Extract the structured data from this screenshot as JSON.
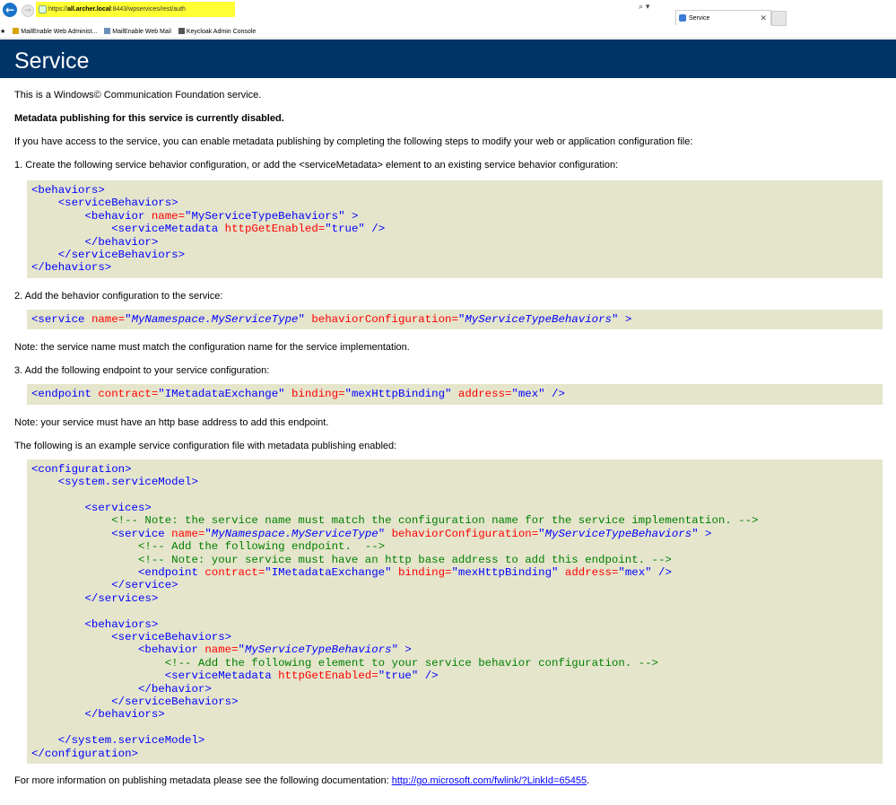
{
  "browser": {
    "address_url_prefix": "https://",
    "address_host": "all.archer.local",
    "address_path": ":8443/wpservices/rest/auth",
    "search_label": "⌕ ▾",
    "tab_title": "Service",
    "tab_close": "✕",
    "favorites": [
      {
        "label": "MailEnable Web Administ..."
      },
      {
        "label": "MailEnable Web Mail"
      },
      {
        "label": "Keycloak Admin Console"
      }
    ]
  },
  "page": {
    "header": "Service",
    "intro": "This is a Windows© Communication Foundation service.",
    "metadata_disabled": "Metadata publishing for this service is currently disabled.",
    "access_text": "If you have access to the service, you can enable metadata publishing by completing the following steps to modify your web or application configuration file:",
    "step1": "1. Create the following service behavior configuration, or add the <serviceMetadata> element to an existing service behavior configuration:",
    "step2": "2. Add the behavior configuration to the service:",
    "note1": "Note: the service name must match the configuration name for the service implementation.",
    "step3": "3. Add the following endpoint to your service configuration:",
    "note2": "Note: your service must have an http base address to add this endpoint.",
    "example_intro": "The following is an example service configuration file with metadata publishing enabled:",
    "footer_text": "For more information on publishing metadata please see the following documentation: ",
    "footer_link": "http://go.microsoft.com/fwlink/?LinkId=65455",
    "footer_end": "."
  },
  "code": {
    "tag_behaviors_open": "<behaviors>",
    "tag_behaviors_close": "</behaviors>",
    "tag_serviceBehaviors_open": "<serviceBehaviors>",
    "tag_serviceBehaviors_close": "</serviceBehaviors>",
    "tag_behavior_open": "<behavior",
    "tag_behavior_close": "</behavior>",
    "tag_serviceMetadata": "<serviceMetadata",
    "tag_service_open": "<service",
    "tag_service_close": "</service>",
    "tag_endpoint": "<endpoint",
    "tag_configuration_open": "<configuration>",
    "tag_configuration_close": "</configuration>",
    "tag_systemServiceModel_open": "<system.serviceModel>",
    "tag_systemServiceModel_close": "</system.serviceModel>",
    "tag_services_open": "<services>",
    "tag_services_close": "</services>",
    "attr_name": "name=",
    "attr_httpGetEnabled": "httpGetEnabled=",
    "attr_behaviorConfiguration": "behaviorConfiguration=",
    "attr_contract": "contract=",
    "attr_binding": "binding=",
    "attr_address": "address=",
    "q": "\"",
    "val_behaviorName": "MyServiceTypeBehaviors",
    "val_true": "true",
    "val_serviceName": "MyNamespace.MyServiceType",
    "val_contract": "IMetadataExchange",
    "val_binding": "mexHttpBinding",
    "val_address": "mex",
    "end_gt": " >",
    "end_selfclose": " />",
    "comment_note_name": "<!-- Note: the service name must match the configuration name for the service implementation. -->",
    "comment_add_endpoint": "<!-- Add the following endpoint.  -->",
    "comment_note_http": "<!-- Note: your service must have an http base address to add this endpoint. -->",
    "comment_add_element": "<!-- Add the following element to your service behavior configuration. -->"
  }
}
